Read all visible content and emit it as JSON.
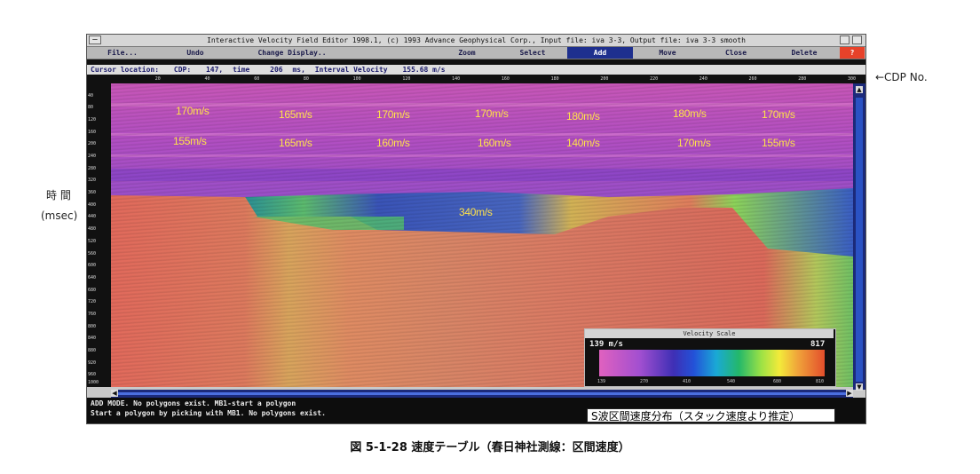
{
  "window": {
    "title": "Interactive Velocity Field Editor 1998.1,  (c) 1993 Advance Geophysical Corp.,  Input file: iva 3-3,  Output file: iva 3-3 smooth",
    "close_glyph": "?"
  },
  "menu": [
    {
      "label": "File..."
    },
    {
      "label": "Undo"
    },
    {
      "label": "Change Display.."
    },
    {
      "label": "Zoom"
    },
    {
      "label": "Select"
    },
    {
      "label": "Add"
    },
    {
      "label": "Move"
    },
    {
      "label": "Close"
    },
    {
      "label": "Delete"
    }
  ],
  "status": {
    "cursor_label": "Cursor location:",
    "cdp_label": "CDP:",
    "cdp_value": "147,",
    "time_label": "time",
    "time_value": "206",
    "time_unit": "ms,",
    "velocity_label": "Interval Velocity",
    "velocity_value": "155.68 m/s"
  },
  "cdp_ticks": [
    "20",
    "40",
    "60",
    "80",
    "100",
    "120",
    "140",
    "160",
    "180",
    "200",
    "220",
    "240",
    "260",
    "280",
    "300"
  ],
  "time_ticks": [
    "40",
    "80",
    "120",
    "160",
    "200",
    "240",
    "280",
    "320",
    "360",
    "400",
    "440",
    "480",
    "520",
    "560",
    "600",
    "640",
    "680",
    "720",
    "760",
    "800",
    "840",
    "880",
    "920",
    "960",
    "1000"
  ],
  "velocity_labels": [
    {
      "text": "170m/s",
      "row": 1
    },
    {
      "text": "165m/s",
      "row": 1
    },
    {
      "text": "170m/s",
      "row": 1
    },
    {
      "text": "170m/s",
      "row": 1
    },
    {
      "text": "180m/s",
      "row": 1
    },
    {
      "text": "180m/s",
      "row": 1
    },
    {
      "text": "170m/s",
      "row": 1
    },
    {
      "text": "155m/s",
      "row": 2
    },
    {
      "text": "165m/s",
      "row": 2
    },
    {
      "text": "160m/s",
      "row": 2
    },
    {
      "text": "160m/s",
      "row": 2
    },
    {
      "text": "140m/s",
      "row": 2
    },
    {
      "text": "170m/s",
      "row": 2
    },
    {
      "text": "155m/s",
      "row": 2
    },
    {
      "text": "340m/s",
      "row": 3
    }
  ],
  "messages": {
    "line1": "ADD MODE.  No polygons exist.  MB1-start a polygon",
    "line2": "Start a polygon by picking with MB1.  No polygons exist."
  },
  "caption_box": "S波区間速度分布（スタック速度より推定）",
  "velocity_scale": {
    "title": "Velocity Scale",
    "min_label": "139  m/s",
    "max_label": "817",
    "ticks": [
      "139",
      "270",
      "410",
      "540",
      "680",
      "810"
    ]
  },
  "side_labels": {
    "cdp_no": "←CDP No.",
    "time": "時 間",
    "msec": "(msec)"
  },
  "figure_caption": "図 5-1-28  速度テーブル（春日神社測線：区間速度）"
}
